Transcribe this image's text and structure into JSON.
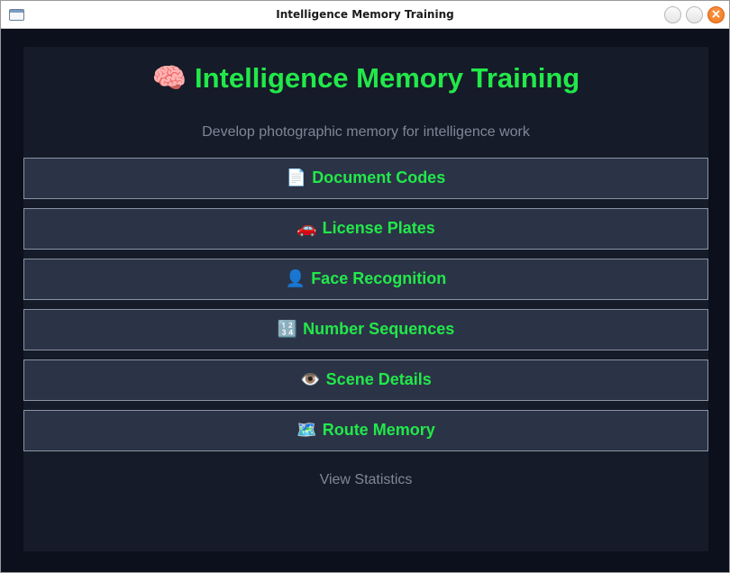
{
  "window": {
    "title": "Intelligence Memory Training",
    "close_glyph": "×"
  },
  "header": {
    "icon": "🧠",
    "title": "Intelligence Memory Training",
    "subtitle": "Develop photographic memory for intelligence work"
  },
  "menu": {
    "items": [
      {
        "icon": "📄",
        "icon_name": "document-icon",
        "label": "Document Codes"
      },
      {
        "icon": "🚗",
        "icon_name": "car-icon",
        "label": "License Plates"
      },
      {
        "icon": "👤",
        "icon_name": "person-icon",
        "label": "Face Recognition"
      },
      {
        "icon": "🔢",
        "icon_name": "numbers-icon",
        "label": "Number Sequences"
      },
      {
        "icon": "👁️",
        "icon_name": "eye-icon",
        "label": "Scene Details"
      },
      {
        "icon": "🗺️",
        "icon_name": "map-icon",
        "label": "Route Memory"
      }
    ]
  },
  "footer": {
    "stats_link": "View Statistics"
  },
  "colors": {
    "accent": "#22e84a",
    "panel": "#151b28",
    "background": "#0b101c",
    "button": "#2b3446",
    "muted_text": "#7f8797"
  }
}
